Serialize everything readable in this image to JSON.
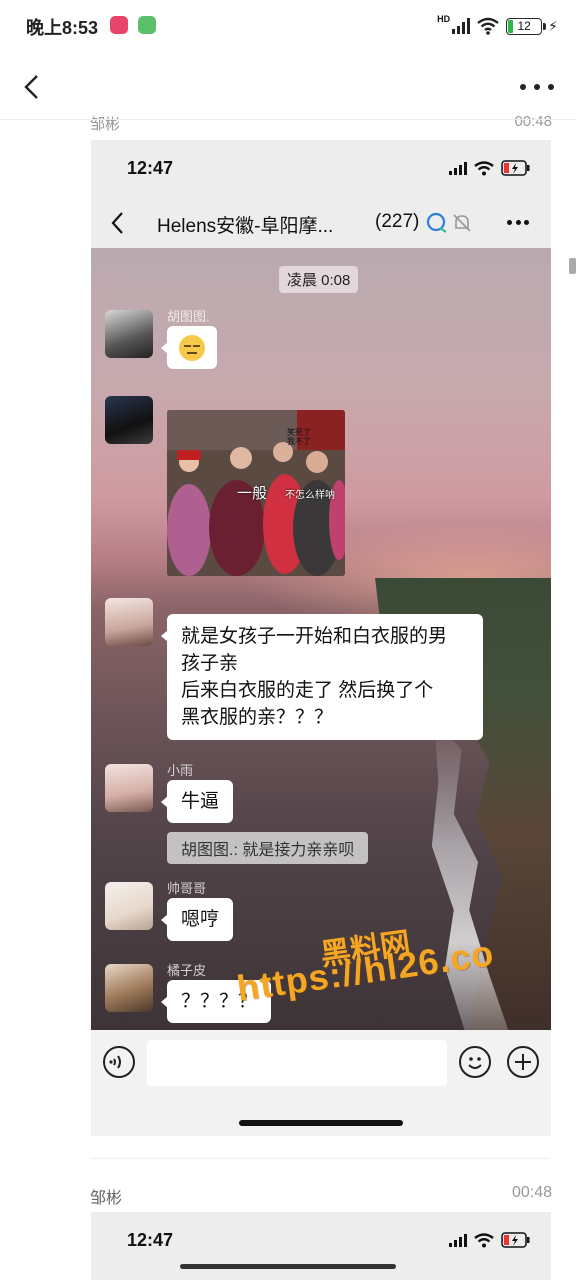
{
  "status_bar": {
    "time": "晚上8:53",
    "network_label": "HD",
    "battery": "12"
  },
  "chat_header": {
    "back": "‹",
    "more": "more"
  },
  "partial_entry": {
    "name": "邹彬",
    "time": "00:48"
  },
  "screenshot": {
    "status_time": "12:47",
    "nav": {
      "title": "Helens安徽-阜阳摩...",
      "count": "(227)"
    },
    "timestamp": "凌晨 0:08",
    "messages": [
      {
        "sender": "胡图图.",
        "type": "emoji"
      },
      {
        "sender": "",
        "type": "image",
        "image_caption_left": "一般",
        "image_caption_right": "不怎么样呐",
        "image_caption_top": "笑死了 我不了"
      },
      {
        "sender": "",
        "type": "text",
        "text_lines": [
          "就是女孩子一开始和白衣服的男",
          "孩子亲",
          "后来白衣服的走了   然后换了个",
          "黑衣服的亲？？？"
        ]
      },
      {
        "sender": "小雨",
        "type": "text",
        "text": "牛逼"
      },
      {
        "quote": "胡图图.: 就是接力亲亲呗"
      },
      {
        "sender": "帅哥哥",
        "type": "text",
        "text": "嗯哼"
      },
      {
        "sender": "橘子皮",
        "type": "text",
        "text": "？？？？"
      }
    ]
  },
  "watermark": {
    "line1": "黑料网",
    "line2": "https://hl26.co"
  },
  "second_entry": {
    "name": "邹彬",
    "time": "00:48",
    "status_time": "12:47"
  },
  "colors": {
    "accent_green": "#2fb84a",
    "watermark": "#f5a623"
  }
}
